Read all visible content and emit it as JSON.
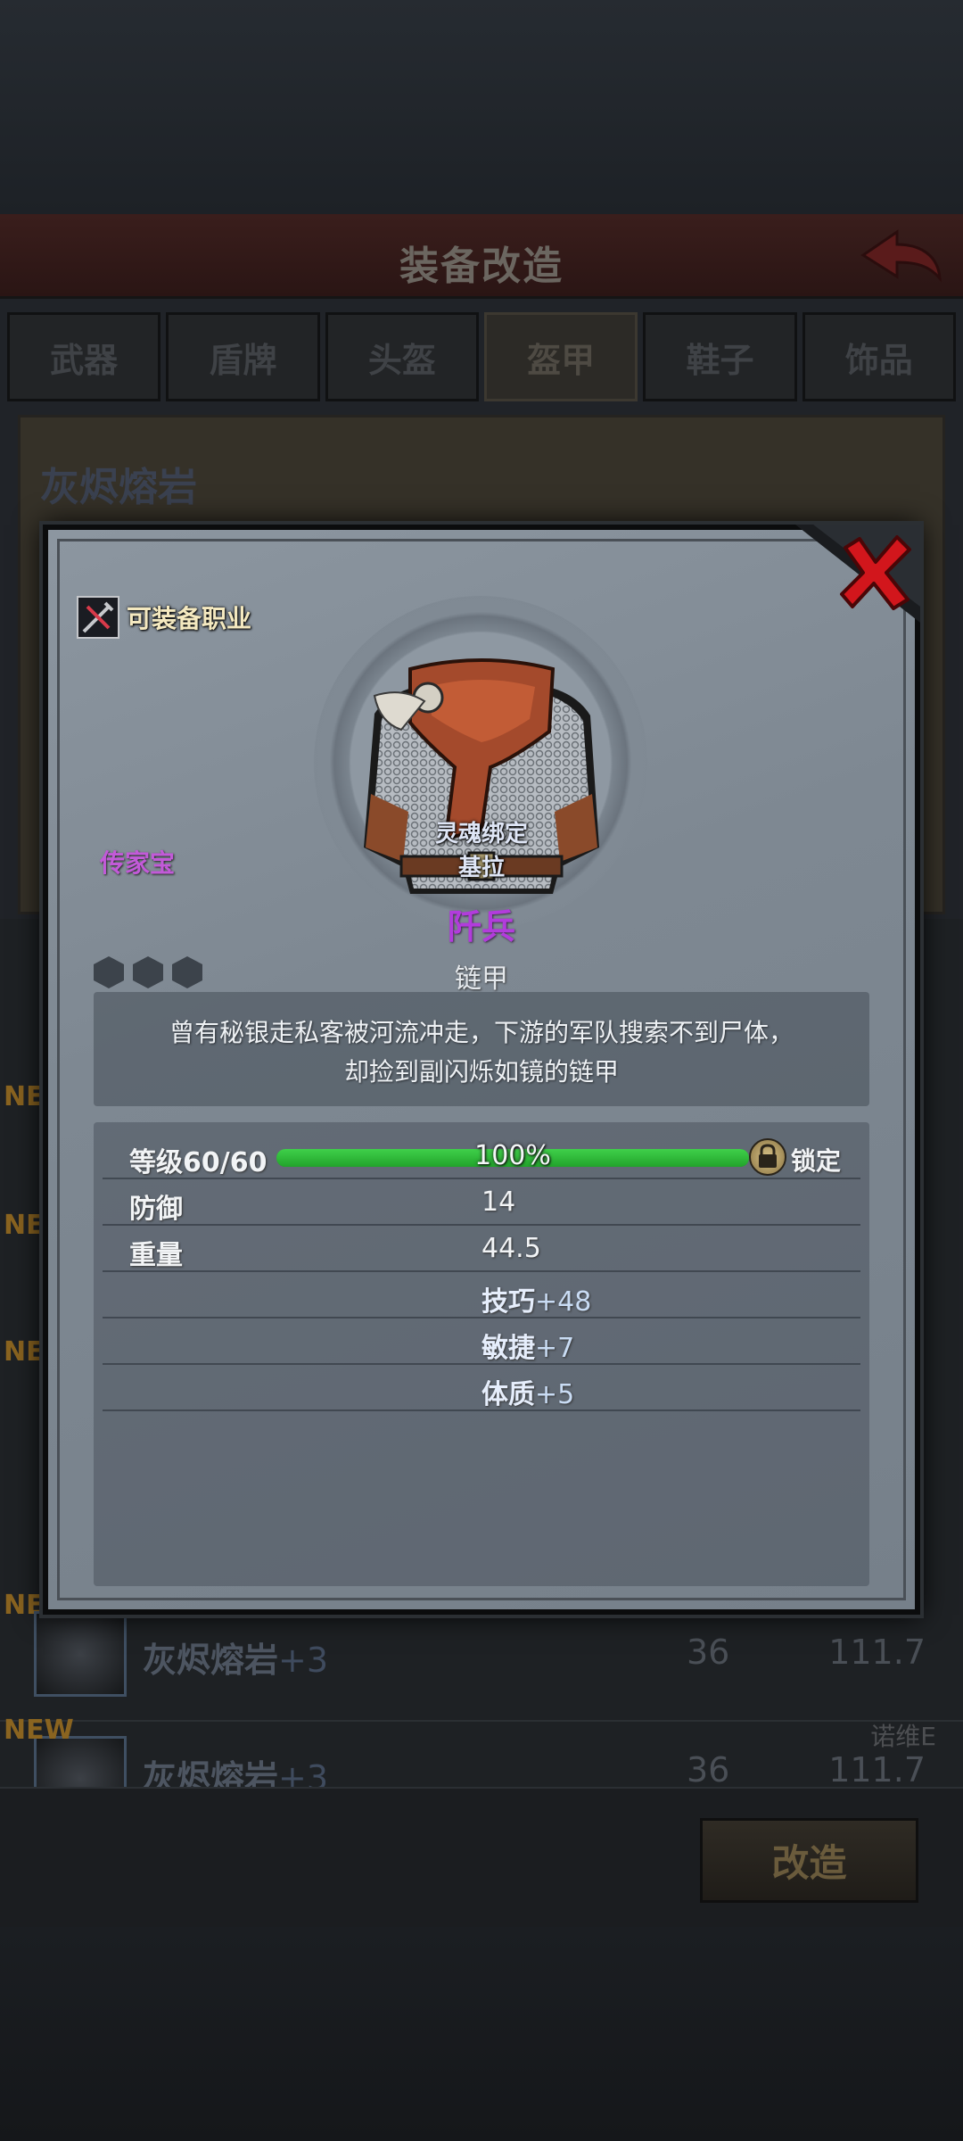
{
  "header": {
    "title": "装备改造"
  },
  "tabs": [
    {
      "label": "武器"
    },
    {
      "label": "盾牌"
    },
    {
      "label": "头盔"
    },
    {
      "label": "盔甲",
      "active": true
    },
    {
      "label": "鞋子"
    },
    {
      "label": "饰品"
    }
  ],
  "panel": {
    "title": "灰烬熔岩"
  },
  "list": {
    "new_badge": "NEW",
    "rows": [
      {
        "name": "灰烬熔岩",
        "plus": "+3",
        "v1": "36",
        "v2": "111.7",
        "tag": ""
      },
      {
        "name": "灰烬熔岩",
        "plus": "+3",
        "v1": "36",
        "v2": "111.7",
        "tag": "诺维E"
      }
    ]
  },
  "refit_button": "改造",
  "modal": {
    "job_label": "可装备职业",
    "heirloom_label": "传家宝",
    "soulbind_label": "灵魂绑定",
    "soulbind_owner": "基拉",
    "item_name": "阡兵",
    "item_type": "链甲",
    "description_line1": "曾有秘银走私客被河流冲走，下游的军队搜索不到尸体，",
    "description_line2": "却捡到副闪烁如镜的链甲",
    "level": {
      "label": "等级60/60",
      "progress_percent": 100,
      "progress_text": "100%",
      "lock_label": "锁定"
    },
    "stats": [
      {
        "label": "防御",
        "value": "14"
      },
      {
        "label": "重量",
        "value": "44.5"
      }
    ],
    "bonuses": [
      {
        "name": "技巧",
        "value": "+48"
      },
      {
        "name": "敏捷",
        "value": "+7"
      },
      {
        "name": "体质",
        "value": "+5"
      }
    ]
  },
  "colors": {
    "heirloom": "#c25ad8",
    "item_name": "#b23cdc",
    "progress_fill": "#2fbe3a",
    "close_x": "#d2161c"
  }
}
